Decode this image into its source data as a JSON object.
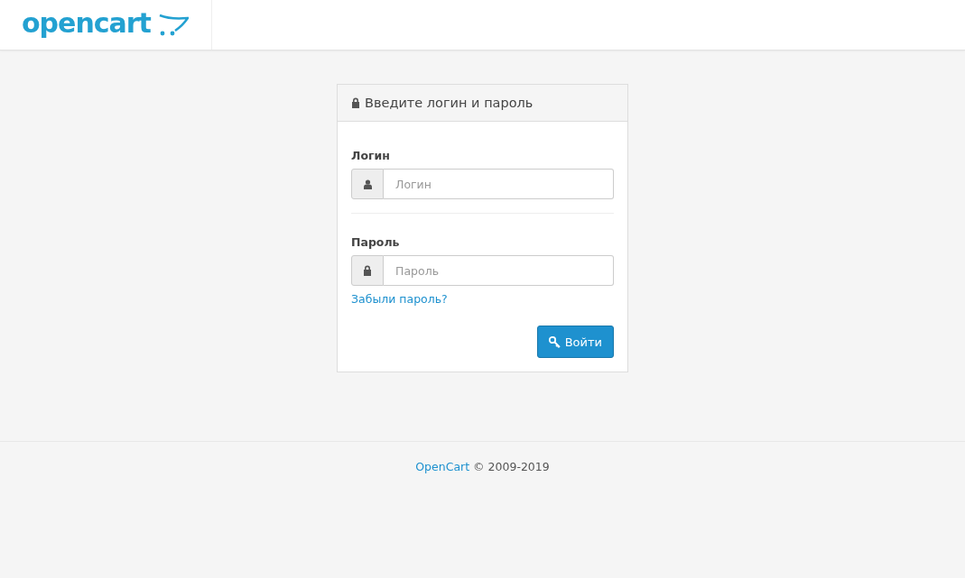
{
  "header": {
    "logo": "opencart"
  },
  "login_panel": {
    "title": "Введите логин и пароль",
    "fields": [
      {
        "label": "Логин",
        "placeholder": "Логин",
        "kind": "user"
      },
      {
        "label": "Пароль",
        "placeholder": "Пароль",
        "kind": "password"
      }
    ],
    "forgot_link": "Забыли пароль?",
    "submit_button": "Войти"
  },
  "footer": {
    "link": "OpenCart",
    "text": "© 2009-2019"
  }
}
